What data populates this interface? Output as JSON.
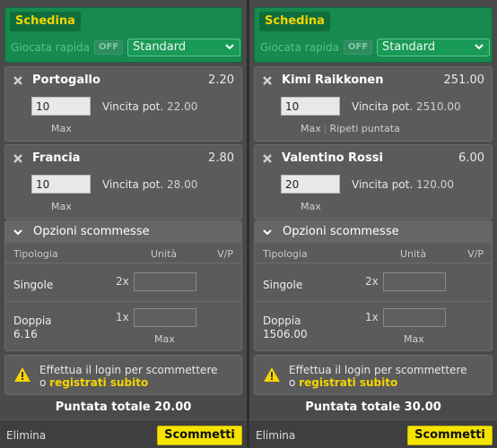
{
  "slips": [
    {
      "title": "Schedina",
      "quick_bet_label": "Giocata rapida",
      "quick_bet_toggle": "OFF",
      "bet_type_selected": "Standard",
      "selections": [
        {
          "name": "Portogallo",
          "odds": "2.20",
          "stake": "10",
          "win_label": "Vincita pot.",
          "win_value": "22.00",
          "links": [
            "Max"
          ]
        },
        {
          "name": "Francia",
          "odds": "2.80",
          "stake": "10",
          "win_label": "Vincita pot.",
          "win_value": "28.00",
          "links": [
            "Max"
          ]
        }
      ],
      "options": {
        "title": "Opzioni scommesse",
        "col_type": "Tipologia",
        "col_units": "Unità",
        "col_vp": "V/P",
        "rows": [
          {
            "label": "Singole",
            "sub": "",
            "mult": "2x"
          },
          {
            "label": "Doppia",
            "sub": "6.16",
            "mult": "1x"
          }
        ],
        "max_label": "Max"
      },
      "login": {
        "line1": "Effettua il login per scommettere",
        "prefix": "o",
        "link": "registrati subito"
      },
      "total": "Puntata totale 20.00",
      "delete_label": "Elimina",
      "submit_label": "Scommetti"
    },
    {
      "title": "Schedina",
      "quick_bet_label": "Giocata rapida",
      "quick_bet_toggle": "OFF",
      "bet_type_selected": "Standard",
      "selections": [
        {
          "name": "Kimi Raikkonen",
          "odds": "251.00",
          "stake": "10",
          "win_label": "Vincita pot.",
          "win_value": "2510.00",
          "links": [
            "Max",
            "Ripeti puntata"
          ]
        },
        {
          "name": "Valentino Rossi",
          "odds": "6.00",
          "stake": "20",
          "win_label": "Vincita pot.",
          "win_value": "120.00",
          "links": [
            "Max"
          ]
        }
      ],
      "options": {
        "title": "Opzioni scommesse",
        "col_type": "Tipologia",
        "col_units": "Unità",
        "col_vp": "V/P",
        "rows": [
          {
            "label": "Singole",
            "sub": "",
            "mult": "2x"
          },
          {
            "label": "Doppia",
            "sub": "1506.00",
            "mult": "1x"
          }
        ],
        "max_label": "Max"
      },
      "login": {
        "line1": "Effettua il login per scommettere",
        "prefix": "o",
        "link": "registrati subito"
      },
      "total": "Puntata totale 30.00",
      "delete_label": "Elimina",
      "submit_label": "Scommetti"
    }
  ]
}
